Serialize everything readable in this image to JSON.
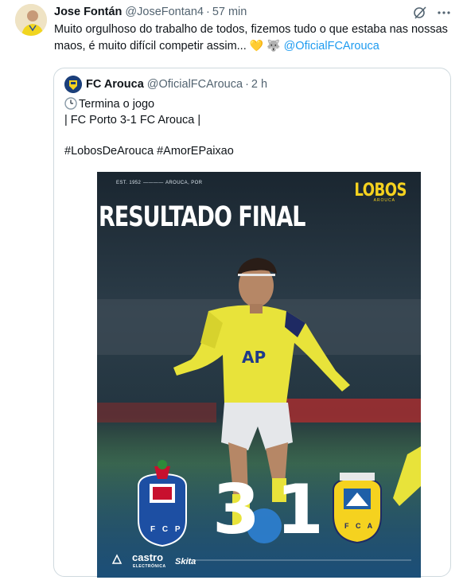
{
  "tweet": {
    "author_name": "Jose Fontán",
    "author_handle": "@JoseFontan4",
    "separator": "·",
    "time": "57 min",
    "text": "Muito orgulhoso do trabalho de todos, fizemos tudo o que estaba nas nossas maos, é muito difícil competir assim...",
    "emojis": "💛 🐺",
    "mention": "@OficialFCArouca"
  },
  "quote": {
    "author_name": "FC Arouca",
    "author_handle": "@OficialFCArouca",
    "separator": "·",
    "time": "2 h",
    "line1": "Termina o jogo",
    "line2": "| FC Porto 3-1 FC Arouca |",
    "line3": "#LobosDeArouca #AmorEPaixao"
  },
  "media": {
    "est": "EST. 1952",
    "city": "AROUCA, POR",
    "logo": "LOBOS",
    "logo_sub": "AROUCA",
    "title": "RESULTADO FINAL",
    "home_score": "3",
    "away_score": "1",
    "home_crest_text": "F C P",
    "away_crest_text": "F C A",
    "sponsors": [
      "castro",
      "ELECTRÓNICA",
      "Skita"
    ]
  },
  "colors": {
    "link": "#1d9bf0",
    "secondary_text": "#536471",
    "border": "#cfd9de",
    "jersey_yellow": "#e8e33a",
    "arouca_yellow": "#f5d21f",
    "porto_blue": "#1d4fa3"
  }
}
